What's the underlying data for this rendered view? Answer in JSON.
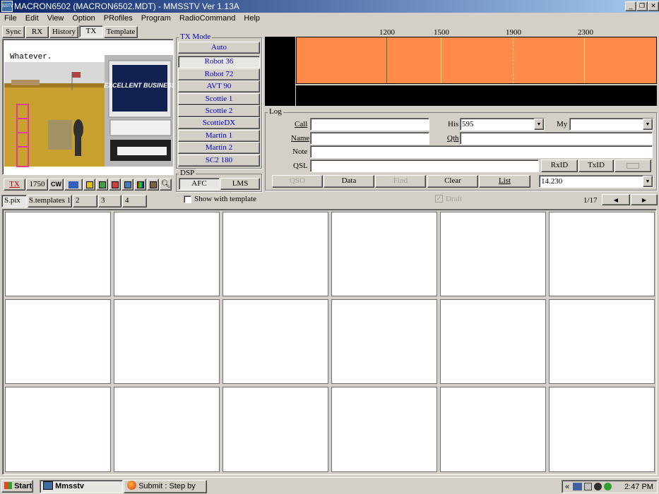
{
  "window": {
    "title": "MACRON6502 (MACRON6502.MDT) - MMSSTV Ver 1.13A",
    "icon_label": "SSTV"
  },
  "menu": [
    "File",
    "Edit",
    "View",
    "Option",
    "PRofiles",
    "Program",
    "RadioCommand",
    "Help"
  ],
  "tabs": [
    "Sync",
    "RX",
    "History",
    "TX",
    "Template"
  ],
  "active_tab": "TX",
  "tx_image": {
    "overlay_text": "Whatever.",
    "monitor_text": "EXCELLENT BUSINESS"
  },
  "tx_toolbar": {
    "tx_label": "TX",
    "tone_label": "1750",
    "cw_label": "CW"
  },
  "tx_mode": {
    "group_label": "TX Mode",
    "modes": [
      "Auto",
      "Robot 36",
      "Robot 72",
      "AVT 90",
      "Scottie 1",
      "Scottie 2",
      "ScottieDX",
      "Martin 1",
      "Martin 2",
      "SC2 180"
    ],
    "selected": "Robot 36"
  },
  "dsp": {
    "group_label": "DSP",
    "afc_label": "AFC",
    "lms_label": "LMS"
  },
  "spectrum": {
    "ticks": [
      "1200",
      "1500",
      "1900",
      "2300"
    ],
    "colors": {
      "band": "#ff8a4a",
      "marker_green": "#3a7a3a",
      "marker_yellow": "#e0e070"
    }
  },
  "log": {
    "group_label": "Log",
    "call_label": "Call",
    "his_label": "His",
    "his_value": "595",
    "my_label": "My",
    "name_label": "Name",
    "qth_label": "Qth",
    "note_label": "Note",
    "qsl_label": "QSL",
    "rxid_label": "RxID",
    "txid_label": "TxID",
    "qso_label": "QSO",
    "data_label": "Data",
    "find_label": "Find",
    "clear_label": "Clear",
    "list_label": "List",
    "freq_value": "14.230"
  },
  "stock_tabs": [
    "S.pix",
    "S.templates 1",
    "2",
    "3",
    "4"
  ],
  "show_with_template": "Show with template",
  "draft_label": "Draft",
  "page_indicator": "1/17",
  "taskbar": {
    "start_label": "Start",
    "tasks": [
      "Mmsstv",
      "Submit : Step by S..."
    ],
    "clock": "2:47 PM"
  }
}
